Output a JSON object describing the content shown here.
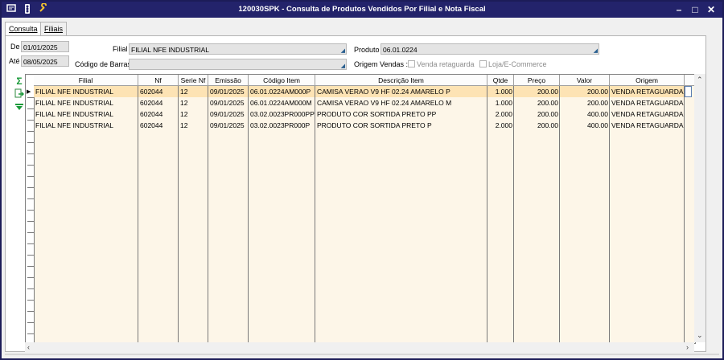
{
  "titlebar": {
    "title": "120030SPK - Consulta de Produtos Vendidos Por Filial e Nota Fiscal",
    "icons": [
      "window-menu-icon",
      "traffic-light-icon",
      "wrench-icon"
    ],
    "controls": [
      "minimize-icon",
      "maximize-icon",
      "close-icon"
    ],
    "color": "#23236b"
  },
  "tabs": [
    {
      "label": "Consulta",
      "active": true
    },
    {
      "label": "Filiais",
      "active": false
    }
  ],
  "filters": {
    "de_label": "De",
    "de_value": "01/01/2025",
    "ate_label": "Até",
    "ate_value": "08/05/2025",
    "filial_label": "Filial",
    "filial_value": "FILIAL NFE INDUSTRIAL",
    "codigo_barras_label": "Código de Barras",
    "codigo_barras_value": "",
    "produto_label": "Produto",
    "produto_value": "06.01.0224",
    "origem_label": "Origem Vendas :",
    "origem_opt1": "Venda retaguarda",
    "origem_opt2": "Loja/E-Commerce"
  },
  "side_icons": [
    "sum-icon",
    "export-icon",
    "filter-down-icon"
  ],
  "grid": {
    "columns": [
      "Filial",
      "Nf",
      "Serie Nf",
      "Emissão",
      "Código Item",
      "Descrição Item",
      "Qtde",
      "Preço",
      "Valor",
      "Origem"
    ],
    "rows": [
      [
        "FILIAL NFE INDUSTRIAL",
        "602044",
        "12",
        "09/01/2025",
        "06.01.0224AM000P",
        "CAMISA VERAO V9  HF 02.24 AMARELO P",
        "1.000",
        "200.00",
        "200.00",
        "VENDA RETAGUARDA"
      ],
      [
        "FILIAL NFE INDUSTRIAL",
        "602044",
        "12",
        "09/01/2025",
        "06.01.0224AM000M",
        "CAMISA VERAO V9  HF 02.24 AMARELO M",
        "1.000",
        "200.00",
        "200.00",
        "VENDA RETAGUARDA"
      ],
      [
        "FILIAL NFE INDUSTRIAL",
        "602044",
        "12",
        "09/01/2025",
        "03.02.0023PR000PP",
        "PRODUTO COR SORTIDA PRETO PP",
        "2.000",
        "200.00",
        "400.00",
        "VENDA RETAGUARDA"
      ],
      [
        "FILIAL NFE INDUSTRIAL",
        "602044",
        "12",
        "09/01/2025",
        "03.02.0023PR000P",
        "PRODUTO COR SORTIDA PRETO P",
        "2.000",
        "200.00",
        "400.00",
        "VENDA RETAGUARDA"
      ]
    ],
    "selected_row": 0,
    "row_color": "#fdf6e8",
    "selected_color": "#fde3b4"
  },
  "scroll": {
    "up": "^",
    "down": "v",
    "left": "<",
    "right": ">"
  }
}
